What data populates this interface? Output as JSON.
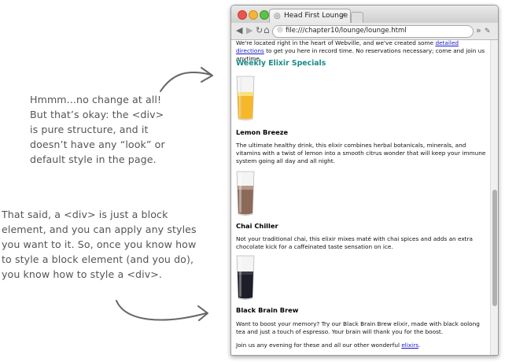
{
  "annotations": {
    "note1": "Hmmm...no change at all!\nBut that’s okay: the <div>\nis pure structure, and it\ndoesn’t have any “look” or\ndefault style in the page.",
    "note2": "That said, a <div> is just a block\nelement, and you can apply any styles\nyou want to it. So, once you know how\nto style a block element (and you do),\nyou know how to style a <div>."
  },
  "browser": {
    "tab_title": "Head First Lounge",
    "tab_close": "×",
    "url": "file:///chapter10/lounge/lounge.html",
    "back": "◀",
    "forward": "▶",
    "reload": "↻",
    "home": "⌂",
    "more": "»",
    "wrench": "🔧"
  },
  "page": {
    "intro_before_link": "We're located right in the heart of Webville, and we've created some ",
    "intro_link": "detailed directions",
    "intro_after_link": " to get you here in record time. No reservations necessary; come and join us anytime.",
    "specials_heading": "Weekly Elixir Specials",
    "elixirs": [
      {
        "name": "Lemon Breeze",
        "description": "The ultimate healthy drink, this elixir combines herbal botanicals, minerals, and vitamins with a twist of lemon into a smooth citrus wonder that will keep your immune system going all day and all night.",
        "color": "#f5b82a"
      },
      {
        "name": "Chai Chiller",
        "description": "Not your traditional chai, this elixir mixes maté with chai spices and adds an extra chocolate kick for a caffeinated taste sensation on ice.",
        "color": "#8c6a5a"
      },
      {
        "name": "Black Brain Brew",
        "description": "Want to boost your memory? Try our Black Brain Brew elixir, made with black oolong tea and just a touch of espresso. Your brain will thank you for the boost.",
        "color": "#1e1e28"
      }
    ],
    "closing_before_link": "Join us any evening for these and all our other wonderful ",
    "closing_link": "elixirs",
    "closing_after_link": "."
  },
  "colors": {
    "heading": "#1a8a8a",
    "link": "#1a1acc"
  }
}
